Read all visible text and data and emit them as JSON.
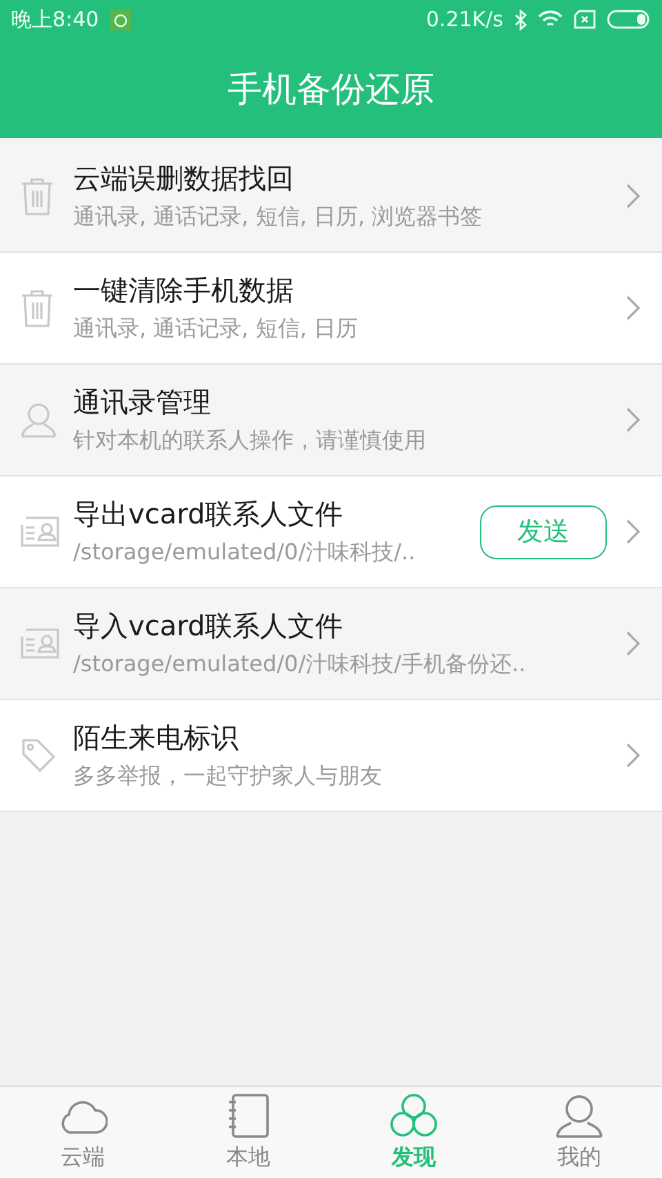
{
  "status_bar": {
    "time": "晚上8:40",
    "speed": "0.21K/s"
  },
  "header": {
    "title": "手机备份还原"
  },
  "items": [
    {
      "kind": "trash",
      "title": "云端误删数据找回",
      "subtitle": "通讯录, 通话记录, 短信, 日历, 浏览器书签"
    },
    {
      "kind": "trash",
      "title": "一键清除手机数据",
      "subtitle": "通讯录, 通话记录, 短信, 日历"
    },
    {
      "kind": "contact",
      "title": "通讯录管理",
      "subtitle": "针对本机的联系人操作，请谨慎使用"
    },
    {
      "kind": "card",
      "title": "导出vcard联系人文件",
      "subtitle": "/storage/emulated/0/汁味科技/..",
      "button": "发送"
    },
    {
      "kind": "card",
      "title": "导入vcard联系人文件",
      "subtitle": "/storage/emulated/0/汁味科技/手机备份还.."
    },
    {
      "kind": "tag",
      "title": "陌生来电标识",
      "subtitle": "多多举报，一起守护家人与朋友"
    }
  ],
  "tabs": [
    {
      "kind": "cloud",
      "label": "云端",
      "selected": false
    },
    {
      "kind": "local",
      "label": "本地",
      "selected": false
    },
    {
      "kind": "discover",
      "label": "发现",
      "selected": true
    },
    {
      "kind": "profile",
      "label": "我的",
      "selected": false
    }
  ]
}
